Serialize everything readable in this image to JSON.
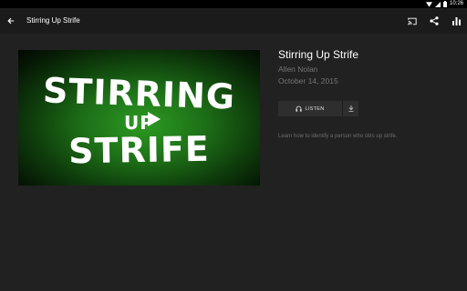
{
  "status_bar": {
    "time": "10:26"
  },
  "app_bar": {
    "title": "Stirring Up Strife"
  },
  "artwork": {
    "line1": "STIRRING",
    "line2": "UP",
    "line3": "STRIFE"
  },
  "episode": {
    "title": "Stirring Up Strife",
    "author": "Allen Nolan",
    "date": "October 14, 2015",
    "listen_label": "LISTEN",
    "description": "Learn how to identify a person who stirs up strife."
  },
  "icons": {
    "back": "arrow-back-icon",
    "cast": "cast-icon",
    "share": "share-icon",
    "stats": "bar-chart-icon",
    "play": "play-icon",
    "headphones": "headphones-icon",
    "download": "download-icon"
  },
  "colors": {
    "background": "#212121",
    "app_bar": "#1b1b1b",
    "button": "#2e2e2e",
    "artwork_green": "#2c9b22"
  }
}
